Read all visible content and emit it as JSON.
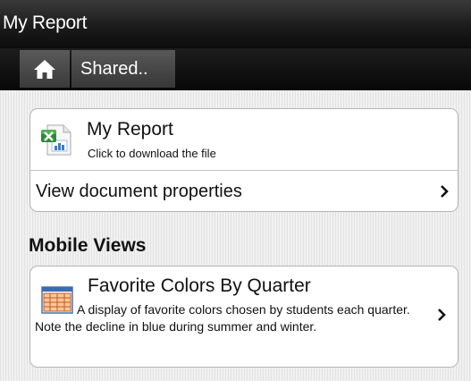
{
  "header": {
    "title": "My Report"
  },
  "breadcrumb": {
    "items": [
      {
        "label": "Shared.."
      }
    ]
  },
  "report_card": {
    "title": "My Report",
    "subtitle": "Click to download the file",
    "properties_label": "View document properties"
  },
  "mobile_views": {
    "heading": "Mobile Views",
    "items": [
      {
        "title": "Favorite Colors By Quarter",
        "description": "A display of favorite colors chosen by students each quarter. Note the decline in blue during summer and winter."
      }
    ]
  },
  "icons": {
    "home": "home-icon",
    "excel": "excel-file-icon",
    "view": "table-view-icon",
    "chevron": "chevron-right-icon"
  },
  "colors": {
    "header_bg": "#1b1b1b",
    "card_bg": "#ffffff",
    "card_border": "#b4b4b4",
    "text": "#111111"
  }
}
